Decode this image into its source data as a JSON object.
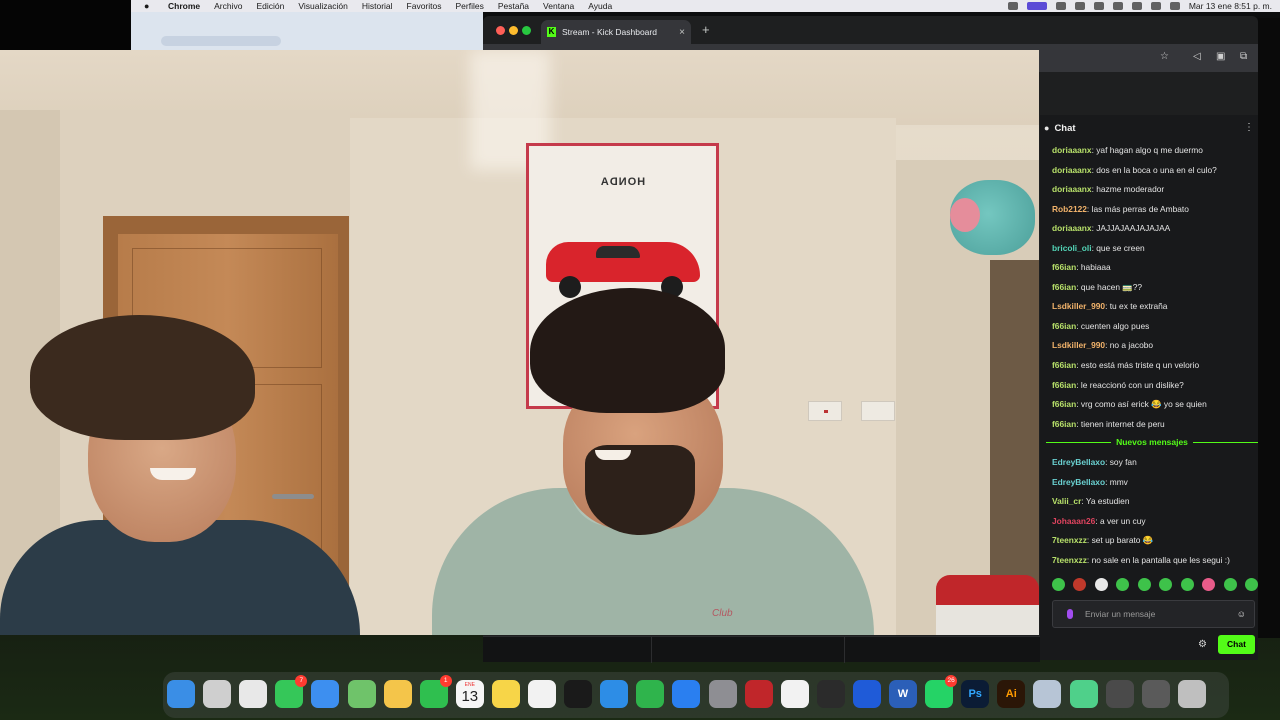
{
  "menubar": {
    "app": "Chrome",
    "items": [
      "Archivo",
      "Edición",
      "Visualización",
      "Historial",
      "Favoritos",
      "Perfiles",
      "Pestaña",
      "Ventana",
      "Ayuda"
    ],
    "clock": "Mar 13 ene  8:51 p. m."
  },
  "browser": {
    "tab_title": "Stream - Kick Dashboard",
    "new_tab": "+",
    "tab_close": "×"
  },
  "video": {
    "poster_brand": "HONDA",
    "shirt_print": "Club"
  },
  "chat": {
    "title": "Chat",
    "messages": [
      {
        "user": "doriaaanx",
        "text": "yaf hagan algo q me duermo",
        "color": "#b7e06a"
      },
      {
        "user": "doriaaanx",
        "text": "dos en la boca o una en el culo?",
        "color": "#b7e06a"
      },
      {
        "user": "doriaaanx",
        "text": "hazme moderador",
        "color": "#b7e06a"
      },
      {
        "user": "Rob2122",
        "text": "las más perras de Ambato",
        "color": "#f2b36b"
      },
      {
        "user": "doriaaanx",
        "text": "JAJJAJAAJAJAJAA",
        "color": "#b7e06a"
      },
      {
        "user": "bricoli_oli",
        "text": "que se creen",
        "color": "#53d6b8"
      },
      {
        "user": "f66ian",
        "text": "habiaaa",
        "color": "#b7e06a"
      },
      {
        "user": "f66ian",
        "text": "que hacen 🚃??",
        "color": "#b7e06a"
      },
      {
        "user": "Lsdkiller_990",
        "text": "tu ex te extraña",
        "color": "#f2b36b"
      },
      {
        "user": "f66ian",
        "text": "cuenten algo pues",
        "color": "#b7e06a"
      },
      {
        "user": "Lsdkiller_990",
        "text": "no a jacobo",
        "color": "#f2b36b"
      },
      {
        "user": "f66ian",
        "text": "esto está más triste q un velorio",
        "color": "#b7e06a"
      },
      {
        "user": "f66ian",
        "text": "le reaccionó con un dislike?",
        "color": "#b7e06a"
      },
      {
        "user": "f66ian",
        "text": "vrg como así erick 😂 yo se quien",
        "color": "#b7e06a"
      },
      {
        "user": "f66ian",
        "text": "tienen internet de peru",
        "color": "#b7e06a"
      }
    ],
    "new_messages_label": "Nuevos mensajes",
    "new_messages": [
      {
        "user": "EdreyBellaxo",
        "text": "soy fan",
        "color": "#6ad1d1"
      },
      {
        "user": "EdreyBellaxo",
        "text": "mmv",
        "color": "#6ad1d1"
      },
      {
        "user": "Valii_cr",
        "text": "Ya estudien",
        "color": "#b7e06a"
      },
      {
        "user": "Johaaan26",
        "text": "a ver un cuy",
        "color": "#e0445f"
      },
      {
        "user": "7teenxzz",
        "text": "set up barato 😂",
        "color": "#b7e06a"
      },
      {
        "user": "7teenxzz",
        "text": "no sale en la pantalla que les segui :)",
        "color": "#b7e06a"
      }
    ],
    "input_placeholder": "Enviar un mensaje",
    "send_label": "Chat"
  },
  "dock": {
    "icons": [
      {
        "name": "finder-icon",
        "color": "#3a8ee6",
        "glyph": ""
      },
      {
        "name": "launchpad-icon",
        "color": "#cfcfcf",
        "glyph": ""
      },
      {
        "name": "chrome-icon",
        "color": "#e8e8e8",
        "glyph": ""
      },
      {
        "name": "messages-icon",
        "color": "#35c759",
        "glyph": "",
        "badge": "7"
      },
      {
        "name": "mail-icon",
        "color": "#3d8ff0",
        "glyph": ""
      },
      {
        "name": "maps-icon",
        "color": "#6fc36a",
        "glyph": ""
      },
      {
        "name": "photos-icon",
        "color": "#f4c54a",
        "glyph": ""
      },
      {
        "name": "facetime-icon",
        "color": "#2fbf4f",
        "glyph": "",
        "badge": "1"
      },
      {
        "name": "calendar-icon",
        "color": "#f6f6f6",
        "glyph": ""
      },
      {
        "name": "notes-icon",
        "color": "#f7d548",
        "glyph": ""
      },
      {
        "name": "freeform-icon",
        "color": "#f2f2f2",
        "glyph": ""
      },
      {
        "name": "spotify-icon",
        "color": "#1a1a1a",
        "glyph": ""
      },
      {
        "name": "keynote-icon",
        "color": "#2d8de6",
        "glyph": ""
      },
      {
        "name": "numbers-icon",
        "color": "#2fb44c",
        "glyph": ""
      },
      {
        "name": "app-store-icon",
        "color": "#2a7ff0",
        "glyph": ""
      },
      {
        "name": "system-settings-icon",
        "color": "#8e8e93",
        "glyph": ""
      },
      {
        "name": "photo-booth-icon",
        "color": "#c0262a",
        "glyph": ""
      },
      {
        "name": "app-icon",
        "color": "#f2f2f2",
        "glyph": ""
      },
      {
        "name": "utility-icon",
        "color": "#2b2b2b",
        "glyph": ""
      },
      {
        "name": "game-controller-icon",
        "color": "#1f5bd8",
        "glyph": ""
      },
      {
        "name": "word-icon",
        "color": "#2b5fb8",
        "glyph": "W"
      },
      {
        "name": "whatsapp-icon",
        "color": "#25d366",
        "glyph": "",
        "badge": "26"
      },
      {
        "name": "photoshop-icon",
        "color": "#0b1c35",
        "glyph": "Ps"
      },
      {
        "name": "illustrator-icon",
        "color": "#2b1607",
        "glyph": "Ai"
      },
      {
        "name": "preview-icon",
        "color": "#b7c5d6",
        "glyph": ""
      },
      {
        "name": "app-icon-2",
        "color": "#4fd08a",
        "glyph": ""
      },
      {
        "name": "downloads-stack-icon",
        "color": "#4a4a4a",
        "glyph": ""
      },
      {
        "name": "recent-stack-icon",
        "color": "#5a5a5a",
        "glyph": ""
      },
      {
        "name": "trash-icon",
        "color": "#bfbfbf",
        "glyph": ""
      }
    ],
    "calendar_month": "ENE",
    "calendar_day": "13"
  }
}
